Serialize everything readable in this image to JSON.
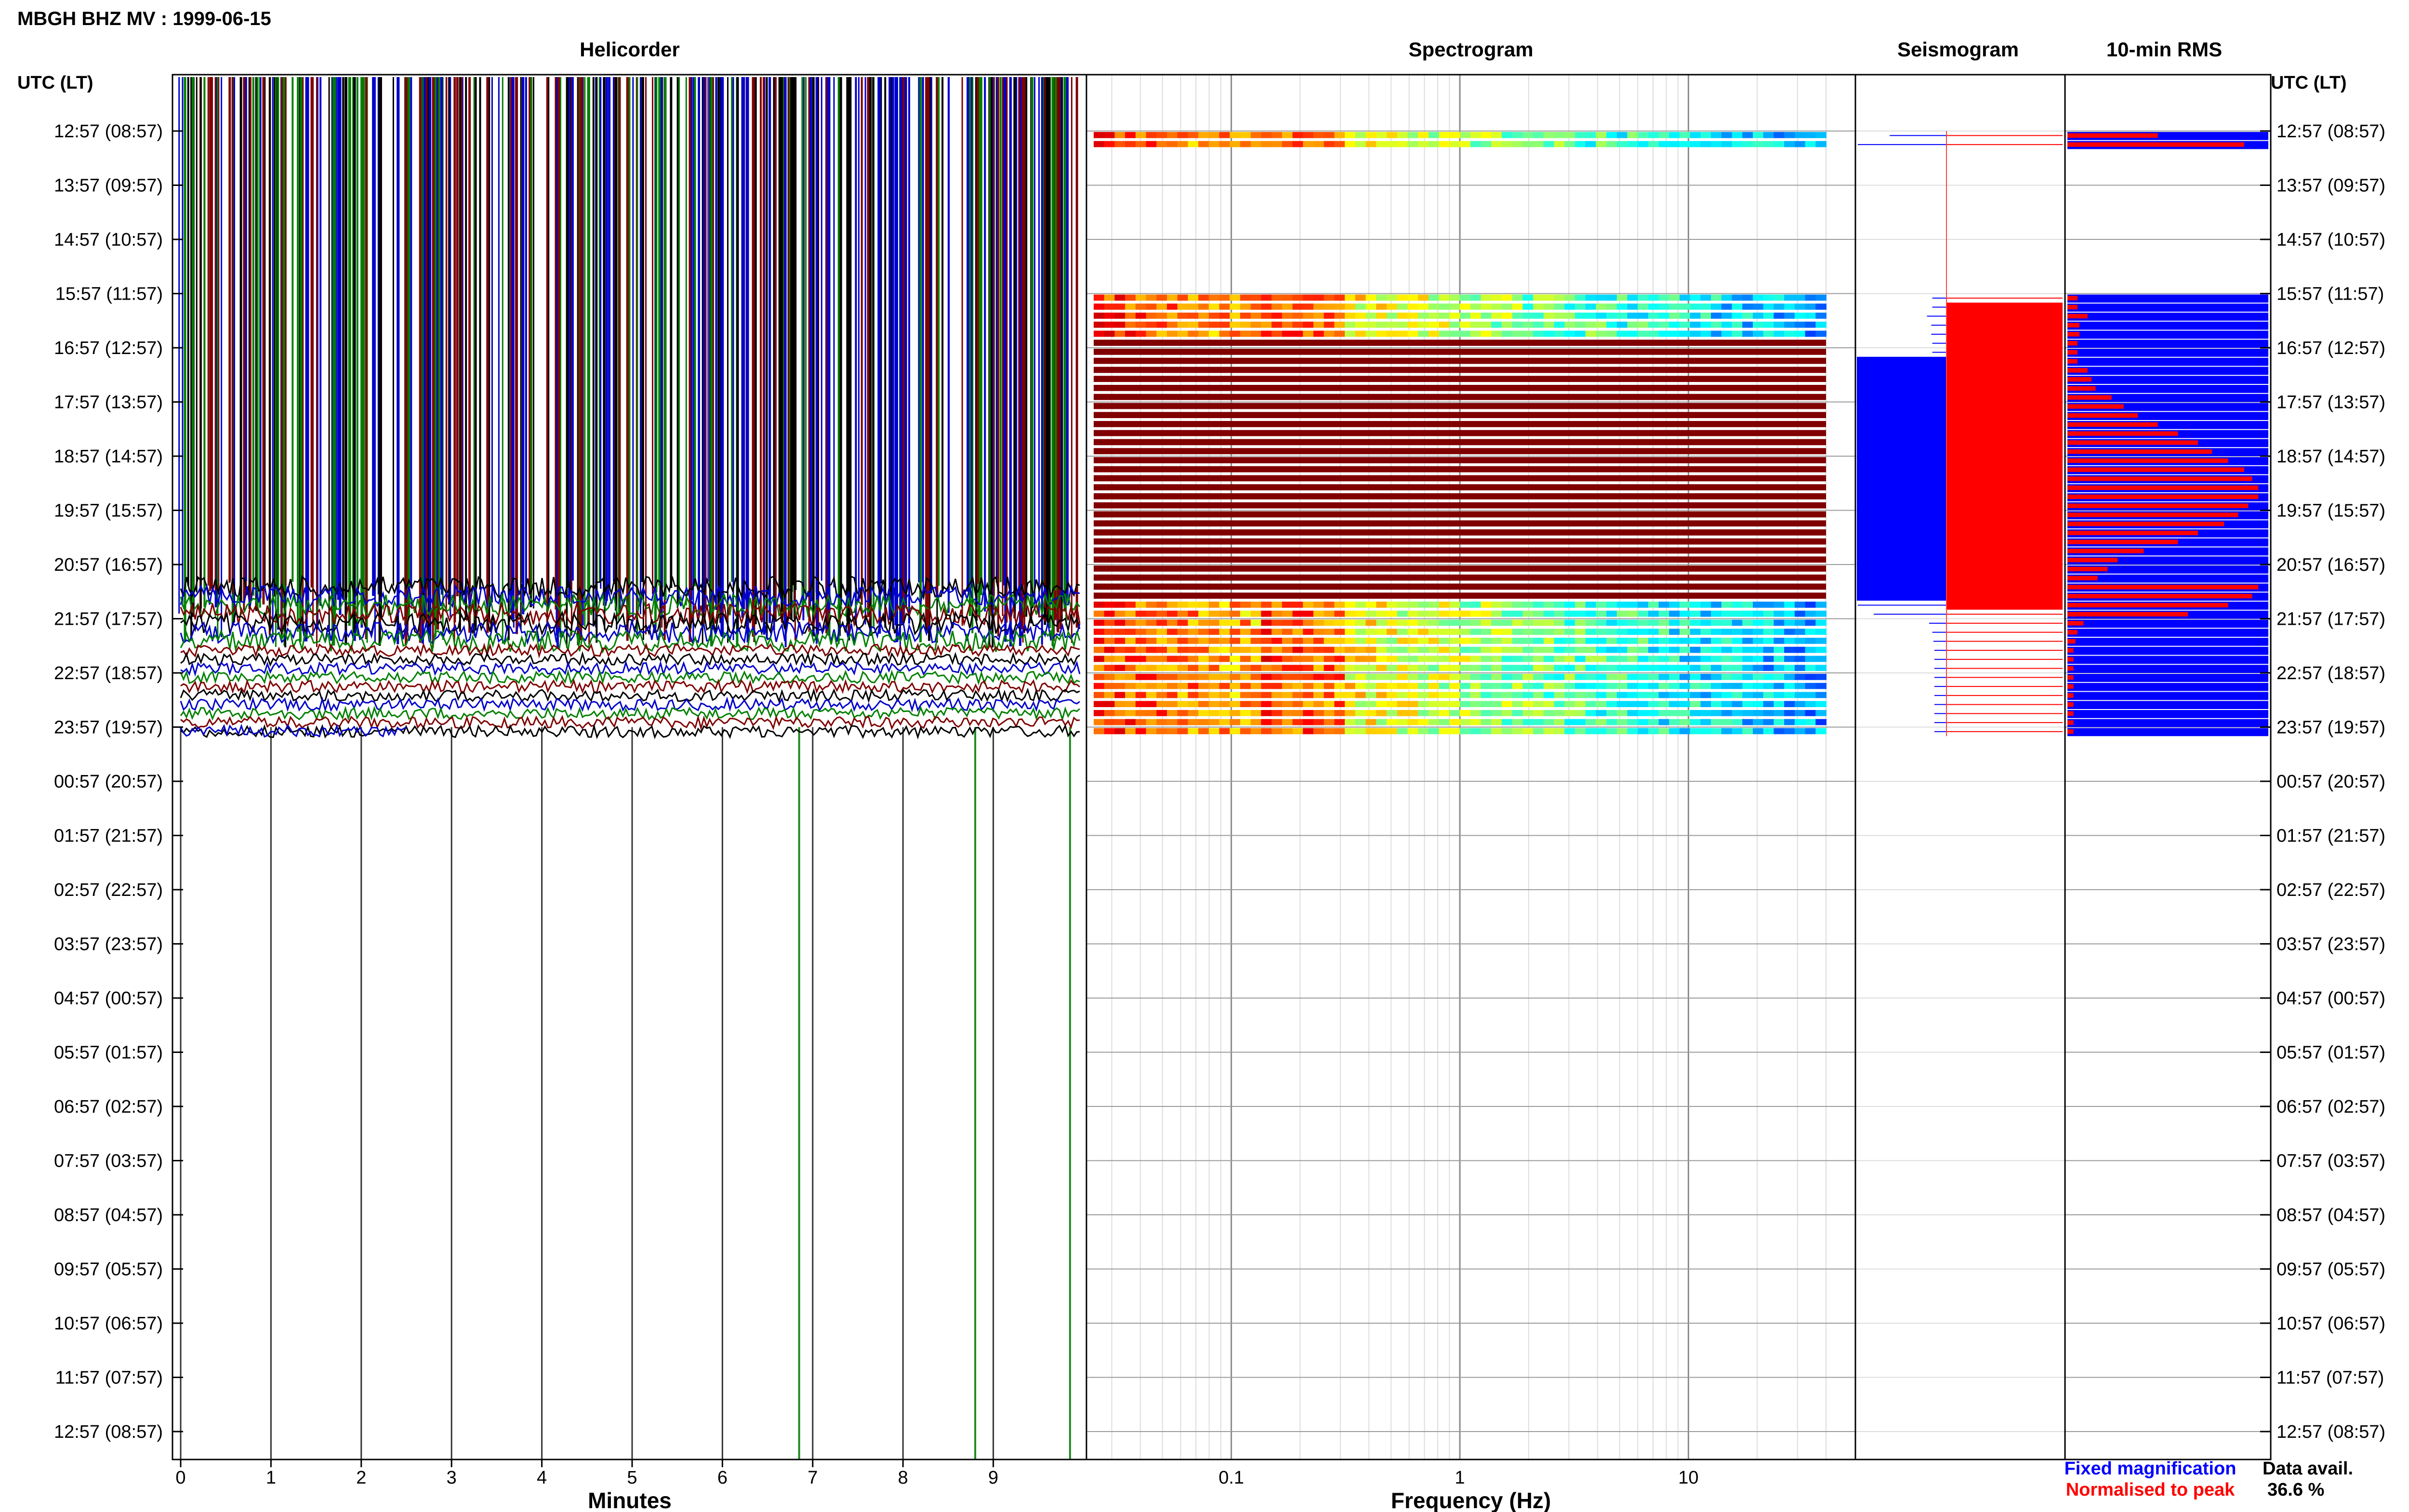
{
  "header": {
    "title": "MBGH BHZ MV : 1999-06-15"
  },
  "panels": {
    "helicorder": "Helicorder",
    "spectrogram": "Spectrogram",
    "seismogram": "Seismogram",
    "rms": "10-min RMS"
  },
  "axis": {
    "time_header": "UTC (LT)",
    "minutes_label": "Minutes",
    "frequency_label": "Frequency (Hz)",
    "minute_ticks": [
      "0",
      "1",
      "2",
      "3",
      "4",
      "5",
      "6",
      "7",
      "8",
      "9"
    ],
    "frequency_ticks": [
      "0.1",
      "1",
      "10"
    ]
  },
  "legend": {
    "fixed": "Fixed magnification",
    "normalised": "Normalised to peak",
    "fixed_color": "#0000ff",
    "normalised_color": "#ff0000"
  },
  "availability": {
    "label": "Data avail.",
    "value": "36.6 %"
  },
  "colors": {
    "trace_cycle": [
      "#000000",
      "#0000cc",
      "#008000",
      "#800000"
    ],
    "spectrogram_saturated": "#800000",
    "rms_fixed": "#0000ff",
    "rms_normalised": "#ff0000"
  },
  "chart_data": {
    "type": "heatmap",
    "title": "MBGH BHZ MV : 1999-06-15",
    "hour_labels": [
      "12:57 (08:57)",
      "13:57 (09:57)",
      "14:57 (10:57)",
      "15:57 (11:57)",
      "16:57 (12:57)",
      "17:57 (13:57)",
      "18:57 (14:57)",
      "19:57 (15:57)",
      "20:57 (16:57)",
      "21:57 (17:57)",
      "22:57 (18:57)",
      "23:57 (19:57)",
      "00:57 (20:57)",
      "01:57 (21:57)",
      "02:57 (22:57)",
      "03:57 (23:57)",
      "04:57 (00:57)",
      "05:57 (01:57)",
      "06:57 (02:57)",
      "07:57 (03:57)",
      "08:57 (04:57)",
      "09:57 (05:57)",
      "10:57 (06:57)",
      "11:57 (07:57)",
      "12:57 (08:57)"
    ],
    "helicorder_xlim": [
      0,
      10
    ],
    "spectrogram_xlim": [
      0.025,
      40
    ],
    "spectrogram_scale": "log",
    "data_rows_minutes": [
      0,
      10,
      180,
      190,
      200,
      210,
      220,
      230,
      240,
      250,
      260,
      270,
      280,
      290,
      300,
      310,
      320,
      330,
      340,
      350,
      360,
      370,
      380,
      390,
      400,
      410,
      420,
      430,
      440,
      450,
      460,
      470,
      480,
      490,
      500,
      510,
      520,
      530,
      540,
      550,
      560,
      570,
      580,
      590,
      600,
      610,
      620,
      630,
      640,
      650,
      660
    ],
    "saturated_span_minutes": [
      230,
      520
    ],
    "rms_normalised": [
      0.45,
      0.88,
      0.05,
      0.05,
      0.1,
      0.06,
      0.06,
      0.05,
      0.05,
      0.05,
      0.1,
      0.12,
      0.14,
      0.22,
      0.28,
      0.35,
      0.45,
      0.55,
      0.65,
      0.72,
      0.8,
      0.88,
      0.92,
      0.95,
      0.95,
      0.9,
      0.85,
      0.78,
      0.65,
      0.55,
      0.38,
      0.25,
      0.2,
      0.15,
      0.95,
      0.92,
      0.8,
      0.6,
      0.08,
      0.05,
      0.04,
      0.03,
      0.03,
      0.03,
      0.03,
      0.03,
      0.03,
      0.03,
      0.03,
      0.03,
      0.03
    ]
  }
}
